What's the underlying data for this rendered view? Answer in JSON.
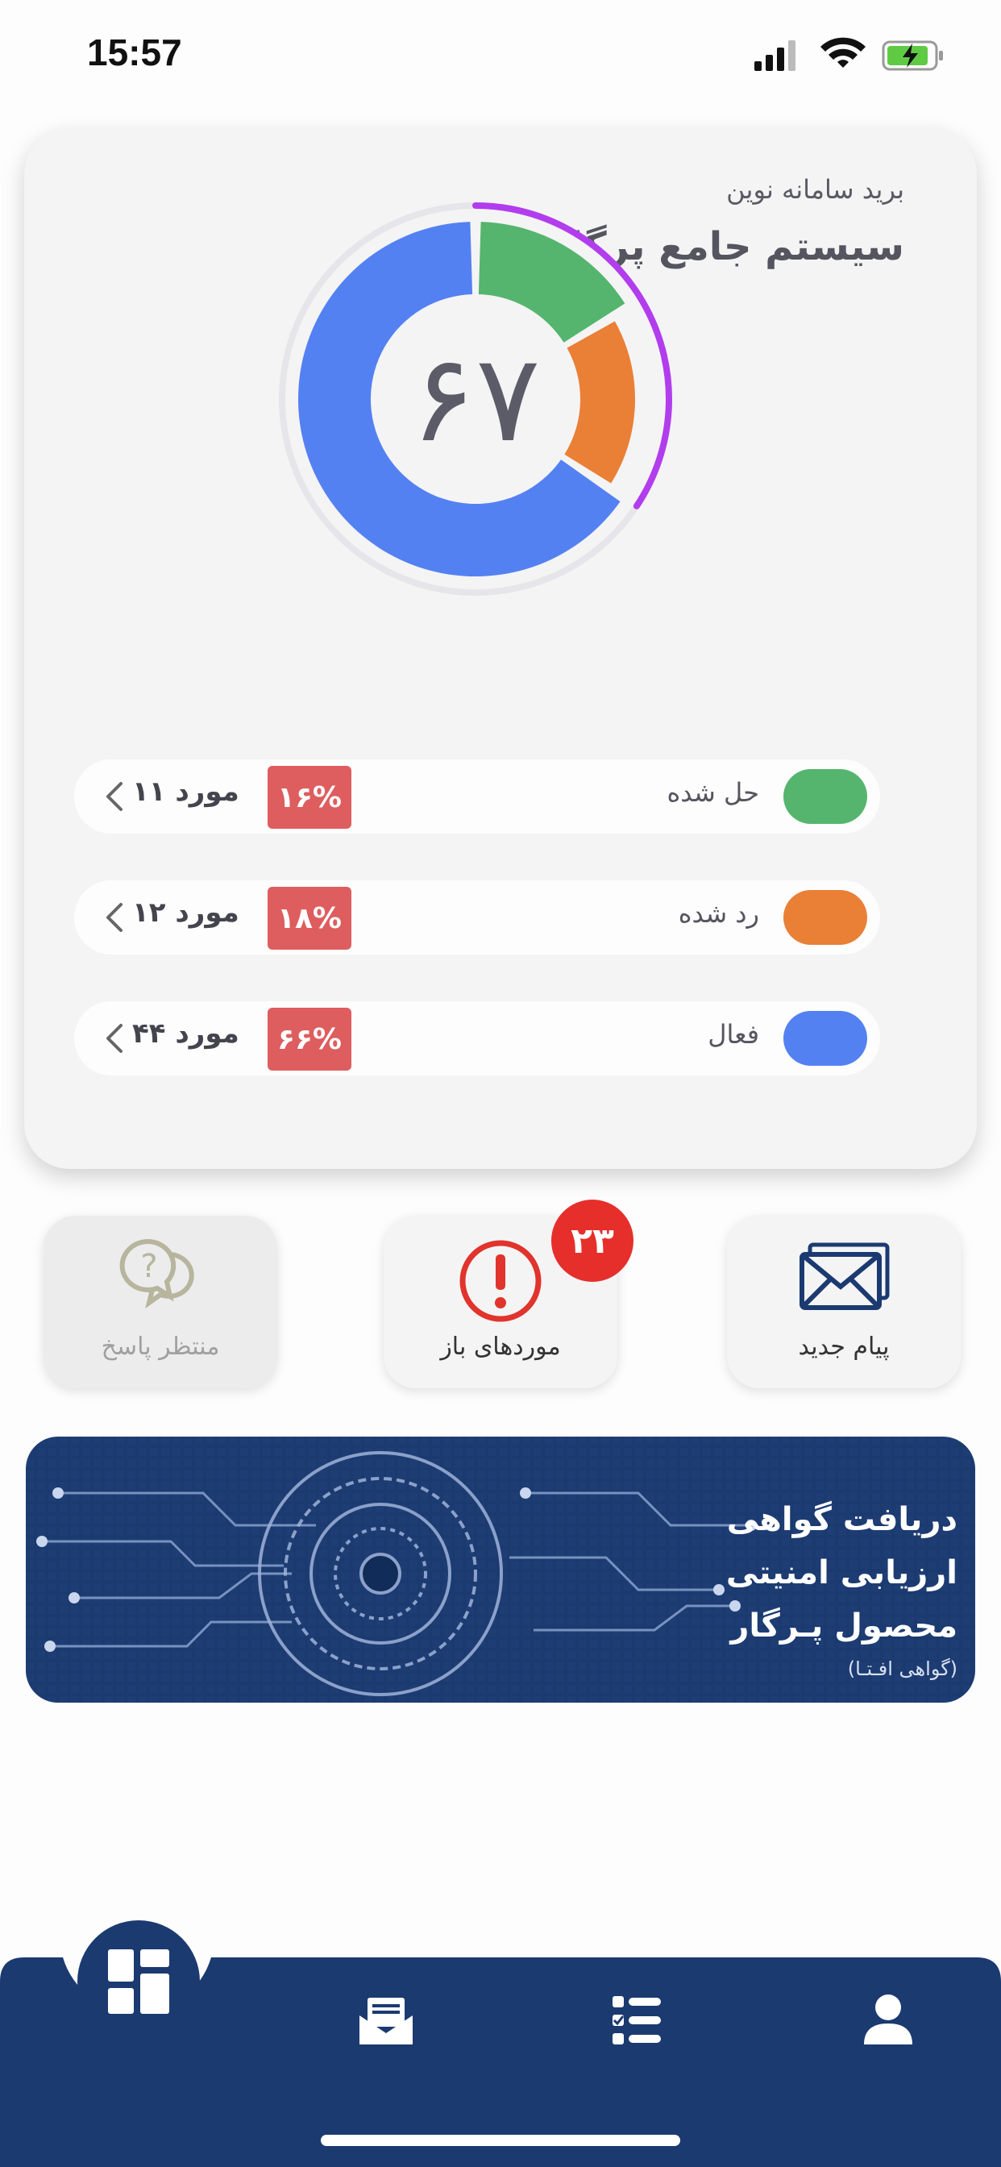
{
  "status_bar": {
    "time": "15:57"
  },
  "card": {
    "subtitle": "برید سامانه نوین",
    "title": "سیستم جامع پرگار",
    "total": "۶۷"
  },
  "chart_data": {
    "type": "pie",
    "categories": [
      "حل شده",
      "رد شده",
      "فعال"
    ],
    "values": [
      11,
      12,
      44
    ],
    "colors": [
      "#55b56e",
      "#ea7f36",
      "#5481f2"
    ],
    "highlight_arc_color": "#b23ded"
  },
  "legend": [
    {
      "label": "حل شده",
      "percent": "۱۶%",
      "count": "مورد ۱۱",
      "color": "#55b56e"
    },
    {
      "label": "رد شده",
      "percent": "۱۸%",
      "count": "مورد ۱۲",
      "color": "#ea7f36"
    },
    {
      "label": "فعال",
      "percent": "۶۶%",
      "count": "مورد ۴۴",
      "color": "#5481f2"
    }
  ],
  "tiles": {
    "new_message": {
      "label": "پیام جدید"
    },
    "open_items": {
      "label": "موردهای باز",
      "badge": "۲۳"
    },
    "awaiting_reply": {
      "label": "منتظر پاسخ"
    }
  },
  "banner": {
    "line1": "دریافت گواهی",
    "line2": "ارزیابی امنیتی",
    "line3": "محصول پـرگار",
    "note": "(گواهی افـتـا)"
  },
  "nav": {
    "items": [
      "dashboard-icon",
      "inbox-icon",
      "checklist-icon",
      "profile-icon"
    ],
    "active": "dashboard-icon",
    "bg_color": "#1b3a70"
  }
}
